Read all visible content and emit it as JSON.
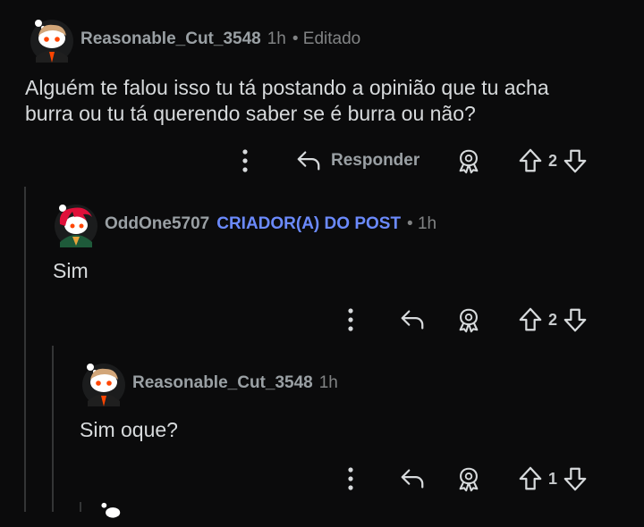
{
  "comments": [
    {
      "username": "Reasonable_Cut_3548",
      "time": "1h",
      "edited": "• Editado",
      "lines": [
        "Alguém te falou isso tu tá postando a opinião que tu acha",
        "burra ou tu tá querendo saber se é burra ou não?"
      ],
      "reply_label": "Responder",
      "votes": "2"
    },
    {
      "username": "OddOne5707",
      "op_badge": "CRIADOR(A) DO POST",
      "time": "• 1h",
      "text": "Sim",
      "votes": "2"
    },
    {
      "username": "Reasonable_Cut_3548",
      "time": "1h",
      "text": "Sim oque?",
      "votes": "1"
    }
  ],
  "icons": {
    "more": "more-vertical-icon",
    "reply": "reply-arrow-icon",
    "award": "award-icon",
    "upvote": "upvote-arrow-icon",
    "downvote": "downvote-arrow-icon"
  },
  "colors": {
    "background": "#0b0b0c",
    "text": "#d7dadc",
    "username": "#9aa0a4",
    "op_badge": "#6b8afd",
    "meta": "#818384",
    "thread_line": "#343536",
    "avatar_orange": "#ff4500",
    "avatar_red_hair": "#e0103a"
  }
}
